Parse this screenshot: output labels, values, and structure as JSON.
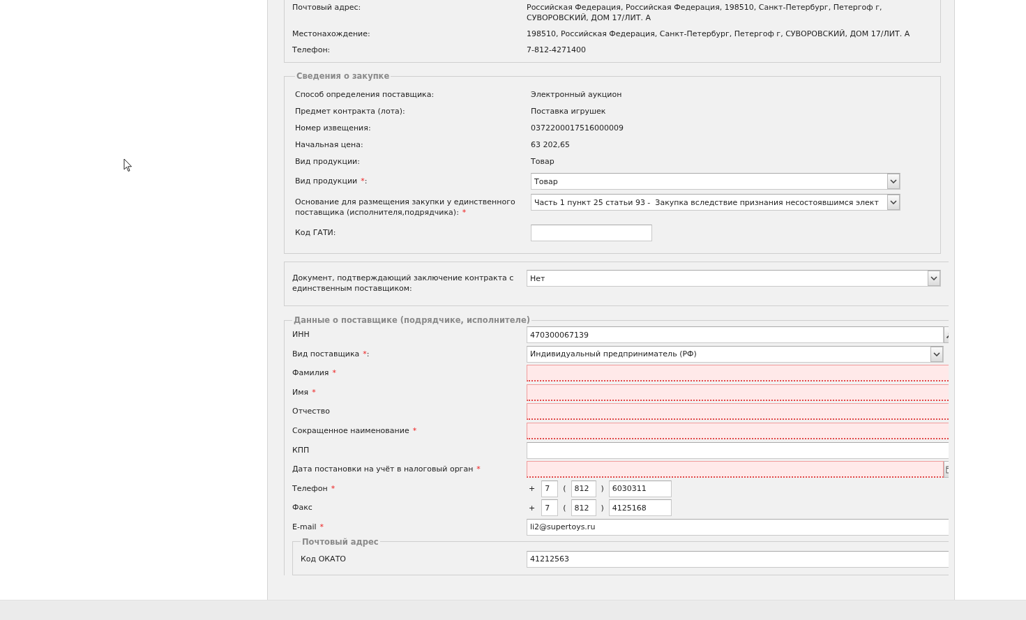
{
  "organization_details": {
    "rows": [
      {
        "label": "Почтовый адрес:",
        "value": "Российская Федерация, Российская Федерация, 198510, Санкт-Петербург, Петергоф г, СУВОРОВСКИЙ, ДОМ 17/ЛИТ. А"
      },
      {
        "label": "Местонахождение:",
        "value": "198510, Российская Федерация, Санкт-Петербург, Петергоф г, СУВОРОВСКИЙ, ДОМ 17/ЛИТ. А"
      },
      {
        "label": "Телефон:",
        "value": "7-812-4271400"
      }
    ]
  },
  "procurement": {
    "title": "Сведения о закупке",
    "rows": [
      {
        "label": "Способ определения поставщика:",
        "value": "Электронный аукцион"
      },
      {
        "label": "Предмет контракта (лота):",
        "value": "Поставка игрушек"
      },
      {
        "label": "Номер извещения:",
        "value": "0372200017516000009"
      },
      {
        "label": "Начальная цена:",
        "value": "63 202,65"
      },
      {
        "label": "Вид продукции:",
        "value": "Товар"
      }
    ],
    "fields": [
      {
        "kind": "select",
        "label": "Вид продукции",
        "required_mark": "*",
        "label_end": ":",
        "value": "Товар",
        "invalid": false
      },
      {
        "kind": "select",
        "label": "Основание для размещения закупки у единственного поставщика (исполнителя,подрядчика):",
        "required_mark": "*",
        "value": "Часть 1 пункт 25 статьи 93 -  Закупка вследствие признания несостоявшимся элект",
        "invalid": false
      },
      {
        "kind": "short",
        "label": "Код ГАТИ:",
        "invalid": false
      }
    ]
  },
  "contract_document": {
    "fields": [
      {
        "kind": "select",
        "label": "Документ, подтверждающий заключение контракта с единственным поставщиком:",
        "value": "Нет",
        "invalid": false
      }
    ]
  },
  "supplier": {
    "title": "Данные о поставщике (подрядчике, исполнителе)",
    "fields": [
      {
        "kind": "lookup",
        "label": "ИНН",
        "value": "470300067139",
        "invalid": false
      },
      {
        "kind": "select",
        "label": "Вид поставщика",
        "required_mark": "*",
        "label_end": ":",
        "value": "Индивидуальный предприниматель (РФ)",
        "invalid": false
      },
      {
        "kind": "text",
        "label": "Фамилия",
        "required_mark": "*",
        "invalid": true
      },
      {
        "kind": "text",
        "label": "Имя",
        "required_mark": "*",
        "invalid": true
      },
      {
        "kind": "text",
        "label": "Отчество",
        "invalid": true
      },
      {
        "kind": "text",
        "label": "Сокращенное наименование",
        "required_mark": "*",
        "invalid": true
      },
      {
        "kind": "text",
        "label": "КПП",
        "invalid": false
      },
      {
        "kind": "date",
        "label": "Дата постановки на учёт в налоговый орган",
        "required_mark": "*",
        "invalid": true
      },
      {
        "kind": "phone",
        "label": "Телефон",
        "required_mark": "*",
        "plus": "+",
        "open": "(",
        "close": ")",
        "country": "7",
        "area": "812",
        "number": "6030311",
        "invalid": false
      },
      {
        "kind": "phone",
        "label": "Факс",
        "plus": "+",
        "open": "(",
        "close": ")",
        "country": "7",
        "area": "812",
        "number": "4125168",
        "invalid": false
      },
      {
        "kind": "text",
        "label": "E-mail",
        "required_mark": "*",
        "value": "li2@supertoys.ru",
        "invalid": false
      }
    ],
    "postal_address": {
      "title": "Почтовый адрес",
      "fields": [
        {
          "kind": "text",
          "label": "Код ОКАТО",
          "value": "41212563",
          "invalid": false
        }
      ]
    }
  }
}
